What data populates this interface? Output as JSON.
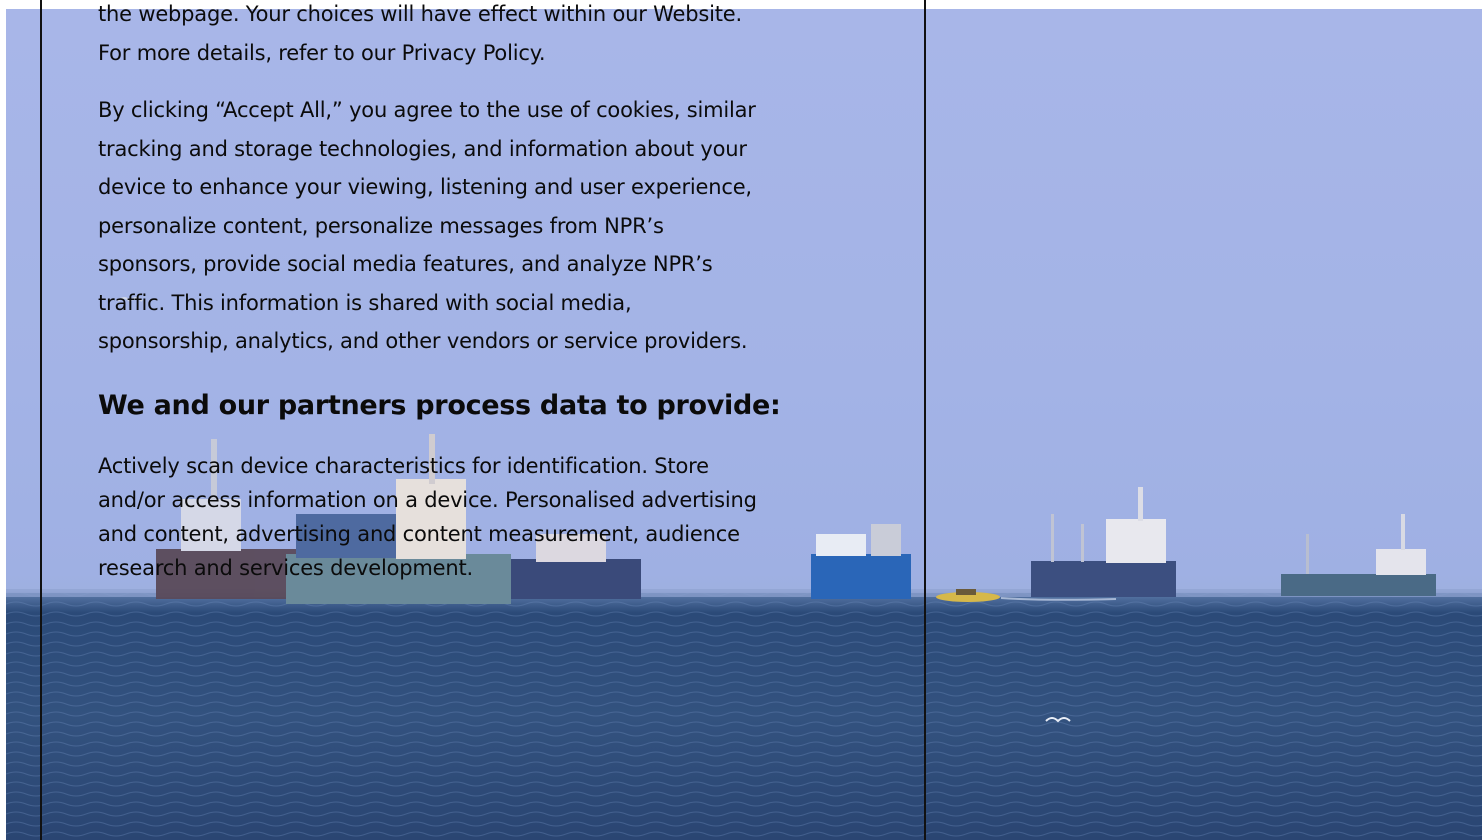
{
  "consent": {
    "intro_lines": [
      "the webpage. Your choices will have effect within our Website.",
      "For more details, refer to our Privacy Policy."
    ],
    "accept_lines": [
      "By clicking “Accept All,” you agree to the use of cookies, similar",
      "tracking and storage technologies, and information about your",
      "device to enhance your viewing, listening and user experience,",
      "personalize content, personalize messages from NPR’s",
      "sponsors, provide social media features, and analyze NPR’s",
      "traffic. This information is shared with social media,",
      "sponsorship, analytics, and other vendors or service providers."
    ],
    "partners_heading": "We and our partners process data to provide:",
    "purposes_lines": [
      "Actively scan device characteristics for identification. Store",
      "and/or access information on a device. Personalised advertising",
      "and content, advertising and content measurement, audience",
      "research and services development."
    ]
  },
  "background": {
    "description_icon": "ships-at-sea-photo",
    "sky_color": "#a6b5e7",
    "sea_color": "#2f4e7a"
  }
}
